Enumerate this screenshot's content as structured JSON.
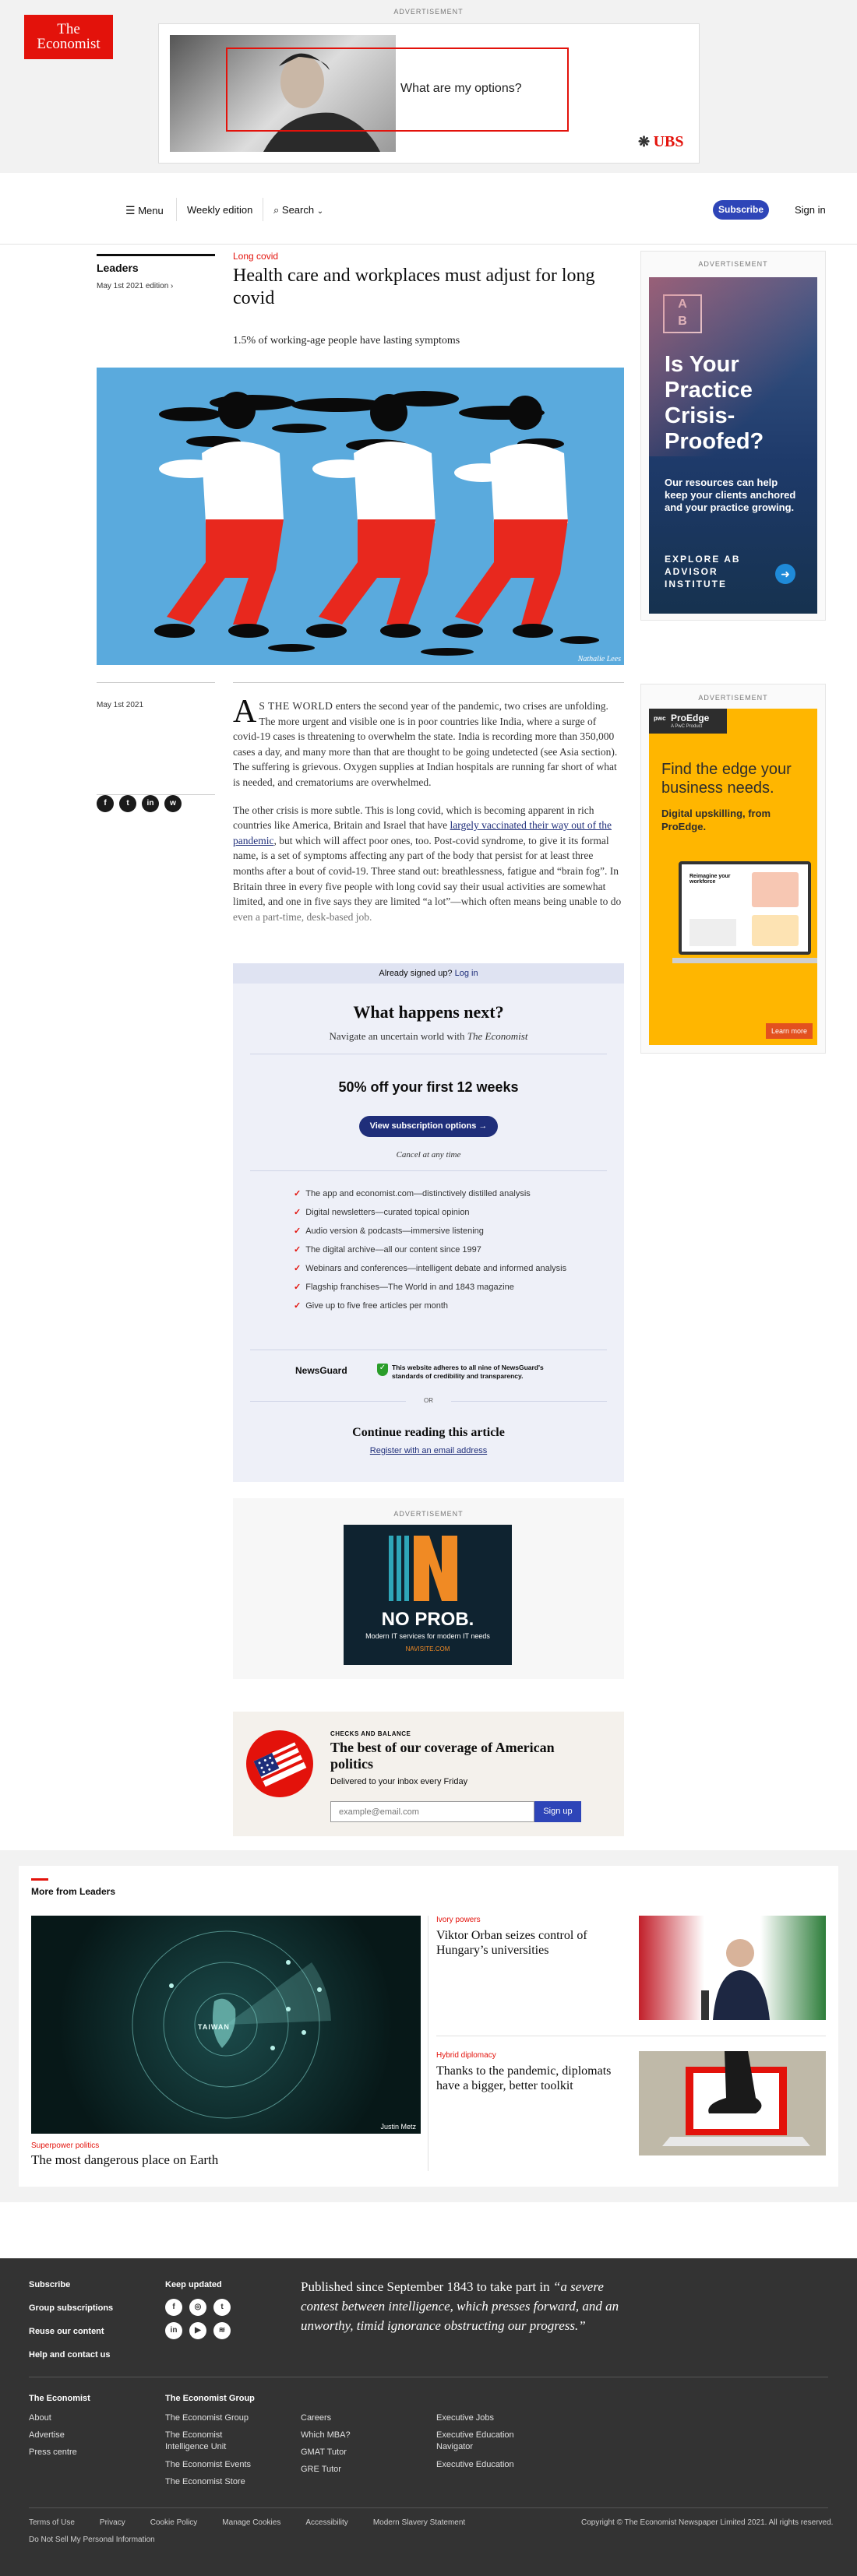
{
  "top_ad": {
    "label": "ADVERTISEMENT",
    "headline": "What are my options?",
    "brand": "UBS"
  },
  "masthead": {
    "logo_line1": "The",
    "logo_line2": "Economist",
    "menu": "Menu",
    "weekly": "Weekly edition",
    "search": "Search",
    "subscribe": "Subscribe",
    "signin": "Sign in"
  },
  "article": {
    "section": "Leaders",
    "edition": "May 1st 2021 edition",
    "kicker": "Long covid",
    "headline": "Health care and workplaces must adjust for long covid",
    "rubric": "1.5% of working-age people have lasting symptoms",
    "credit": "Nathalie Lees",
    "date": "May 1st 2021",
    "dropcap": "A",
    "smallcaps": "S THE WORLD",
    "p1": " enters the second year of the pandemic, two crises are unfolding. The more urgent and visible one is in poor countries like India, where a surge of covid-19 cases is threatening to overwhelm the state. India is recording more than 350,000 cases a day, and many more than that are thought to be going undetected (see Asia section). The suffering is grievous. Oxygen supplies at Indian hospitals are running far short of what is needed, and crematoriums are overwhelmed.",
    "p2a": "The other crisis is more subtle. This is long covid, which is becoming apparent in rich countries like America, Britain and Israel that have ",
    "p2link": "largely vaccinated their way out of the pandemic",
    "p2b": ", but which will affect poor ones, too. Post-covid syndrome, to give it its formal name, is a set of symptoms affecting any part of the body that persist for at least three months after a bout of covid-19. Three stand out: breathlessness, fatigue and “brain fog”. In Britain three in every five people with long covid say their usual activities are somewhat limited, and one in five says they are limited “a lot”—which often means being unable to do even a part-time, desk-based job."
  },
  "paywall": {
    "signed_up": "Already signed up?",
    "login": "Log in",
    "title": "What happens next?",
    "subtitle_pre": "Navigate an uncertain world with ",
    "subtitle_em": "The Economist",
    "offer": "50% off your first 12 weeks",
    "cta": "View subscription options →",
    "cancel": "Cancel at any time",
    "benefits": [
      "The app and economist.com—distinctively distilled analysis",
      "Digital newsletters—curated topical opinion",
      "Audio version & podcasts—immersive listening",
      "The digital archive—all our content since 1997",
      "Webinars and conferences—intelligent debate and informed analysis",
      "Flagship franchises—The World in and 1843 magazine",
      "Give up to five free articles per month"
    ],
    "newsguard": "NewsGuard",
    "newsguard_text": "This website adheres to all nine of NewsGuard's standards of credibility and transparency.",
    "or": "OR",
    "continue_title": "Continue reading this article",
    "register": "Register with an email address"
  },
  "side_ad1": {
    "label": "ADVERTISEMENT",
    "logo_top": "A",
    "logo_bottom": "B",
    "headline": "Is Your Practice Crisis-Proofed?",
    "body": "Our resources can help keep your clients anchored and your practice growing.",
    "cta": "EXPLORE AB ADVISOR INSTITUTE"
  },
  "side_ad2": {
    "label": "ADVERTISEMENT",
    "brand": "ProEdge",
    "brand_sub": "A PwC Product",
    "headline": "Find the edge your business needs.",
    "body": "Digital upskilling, from ProEdge.",
    "cta": "Learn more",
    "screen_title": "Reimagine your workforce"
  },
  "mid_ad": {
    "label": "ADVERTISEMENT",
    "big": "NO PROB.",
    "body": "Modern IT services for modern IT needs",
    "url": "NAVISITE.COM"
  },
  "newsletter": {
    "kicker": "CHECKS AND BALANCE",
    "title": "The best of our coverage of American politics",
    "sub": "Delivered to your inbox every Friday",
    "placeholder": "example@email.com",
    "button": "Sign up"
  },
  "more": {
    "heading": "More from Leaders",
    "main": {
      "kicker": "Superpower politics",
      "title": "The most dangerous place on Earth",
      "credit": "Justin Metz",
      "map_label": "TAIWAN"
    },
    "items": [
      {
        "kicker": "Ivory powers",
        "title": "Viktor Orban seizes control of Hungary’s universities"
      },
      {
        "kicker": "Hybrid diplomacy",
        "title": "Thanks to the pandemic, diplomats have a bigger, better toolkit"
      }
    ]
  },
  "footer": {
    "links1": [
      "Subscribe",
      "Group subscriptions",
      "Reuse our content",
      "Help and contact us"
    ],
    "keep_updated": "Keep updated",
    "quote_pre": "Published since September 1843 to take part in ",
    "quote": "“a severe contest between intelligence, which presses forward, and an unworthy, timid ignorance obstructing our progress.”",
    "col1_head": "The Economist",
    "col1": [
      "About",
      "Advertise",
      "Press centre"
    ],
    "col2_head": "The Economist Group",
    "col2": [
      "The Economist Group",
      "The Economist Intelligence Unit",
      "The Economist Events",
      "The Economist Store"
    ],
    "col3": [
      "Careers",
      "Which MBA?",
      "GMAT Tutor",
      "GRE Tutor"
    ],
    "col4": [
      "Executive Jobs",
      "Executive Education Navigator",
      "Executive Education"
    ],
    "bottom": [
      "Terms of Use",
      "Privacy",
      "Cookie Policy",
      "Manage Cookies",
      "Accessibility",
      "Modern Slavery Statement"
    ],
    "do_not_sell": "Do Not Sell My Personal Information",
    "copyright": "Copyright © The Economist Newspaper Limited 2021. All rights reserved."
  },
  "colors": {
    "brand_red": "#e3120b",
    "brand_blue": "#2e45b8",
    "footer_bg": "#333333"
  }
}
